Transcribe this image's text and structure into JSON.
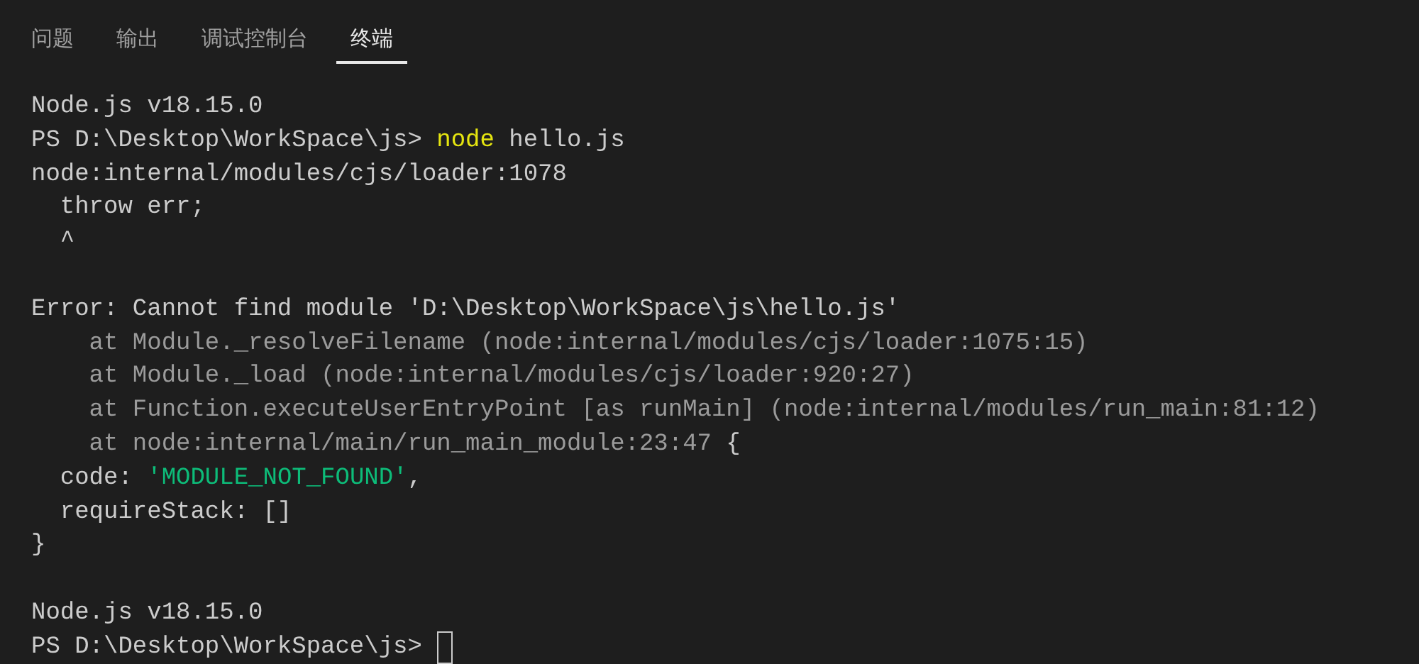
{
  "tabs": [
    {
      "label": "问题",
      "selected": false
    },
    {
      "label": "输出",
      "selected": false
    },
    {
      "label": "调试控制台",
      "selected": false
    },
    {
      "label": "终端",
      "selected": true
    }
  ],
  "terminal": {
    "cursor": true,
    "lines": [
      {
        "kind": "text",
        "segments": [
          {
            "kind": "plain",
            "text": "Node.js v18.15.0"
          }
        ]
      },
      {
        "kind": "text",
        "segments": [
          {
            "kind": "plain",
            "text": "PS D:\\Desktop\\WorkSpace\\js> "
          },
          {
            "kind": "command",
            "text": "node"
          },
          {
            "kind": "plain",
            "text": " hello.js"
          }
        ]
      },
      {
        "kind": "text",
        "segments": [
          {
            "kind": "plain",
            "text": "node:internal/modules/cjs/loader:1078"
          }
        ]
      },
      {
        "kind": "text",
        "segments": [
          {
            "kind": "plain",
            "text": "  throw err;"
          }
        ]
      },
      {
        "kind": "text",
        "segments": [
          {
            "kind": "plain",
            "text": "  ^"
          }
        ]
      },
      {
        "kind": "blank"
      },
      {
        "kind": "text",
        "segments": [
          {
            "kind": "plain",
            "text": "Error: Cannot find module 'D:\\Desktop\\WorkSpace\\js\\hello.js'"
          }
        ]
      },
      {
        "kind": "text",
        "segments": [
          {
            "kind": "dim",
            "text": "    at Module._resolveFilename (node:internal/modules/cjs/loader:1075:15)"
          }
        ]
      },
      {
        "kind": "text",
        "segments": [
          {
            "kind": "dim",
            "text": "    at Module._load (node:internal/modules/cjs/loader:920:27)"
          }
        ]
      },
      {
        "kind": "text",
        "segments": [
          {
            "kind": "dim",
            "text": "    at Function.executeUserEntryPoint [as runMain] (node:internal/modules/run_main:81:12)"
          }
        ]
      },
      {
        "kind": "text",
        "segments": [
          {
            "kind": "dim",
            "text": "    at node:internal/main/run_main_module:23:47"
          },
          {
            "kind": "plain",
            "text": " {"
          }
        ]
      },
      {
        "kind": "text",
        "segments": [
          {
            "kind": "plain",
            "text": "  code: "
          },
          {
            "kind": "string",
            "text": "'MODULE_NOT_FOUND'"
          },
          {
            "kind": "plain",
            "text": ","
          }
        ]
      },
      {
        "kind": "text",
        "segments": [
          {
            "kind": "plain",
            "text": "  requireStack: []"
          }
        ]
      },
      {
        "kind": "text",
        "segments": [
          {
            "kind": "plain",
            "text": "}"
          }
        ]
      },
      {
        "kind": "blank"
      },
      {
        "kind": "text",
        "segments": [
          {
            "kind": "plain",
            "text": "Node.js v18.15.0"
          }
        ]
      },
      {
        "kind": "text",
        "segments": [
          {
            "kind": "plain",
            "text": "PS D:\\Desktop\\WorkSpace\\js> "
          }
        ]
      }
    ]
  }
}
